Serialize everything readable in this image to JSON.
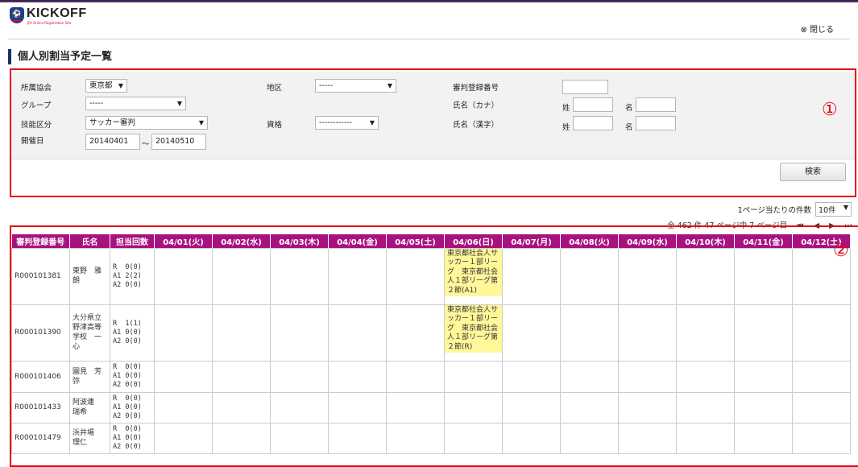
{
  "header": {
    "logo_text": "KICKOFF",
    "logo_sub": "JFA Online Registration Site",
    "close_label": "⊗ 閉じる"
  },
  "page_title": "個人別割当予定一覧",
  "search": {
    "association_label": "所属協会",
    "association_value": "東京都",
    "region_label": "地区",
    "region_value": "-----",
    "referee_no_label": "審判登録番号",
    "referee_no_value": "",
    "group_label": "グループ",
    "group_value": "-----",
    "kana_label": "氏名（カナ）",
    "skill_label": "技能区分",
    "skill_value": "サッカー審判",
    "qualification_label": "資格",
    "qualification_value": "------------",
    "kanji_label": "氏名（漢字）",
    "last_label": "姓",
    "first_label": "名",
    "date_label": "開催日",
    "date_from": "20140401",
    "date_sep": "～",
    "date_to": "20140510",
    "search_button": "検索"
  },
  "annotations": {
    "one": "①",
    "two": "②"
  },
  "pagination": {
    "per_page_label": "1ページ当たりの件数",
    "per_page_value": "10件",
    "summary": "全 462 件 47 ページ中 7 ページ目",
    "first": "⏮",
    "prev": "◀",
    "next": "▶",
    "last": "⏭"
  },
  "table": {
    "columns": [
      "審判登録番号",
      "氏名",
      "担当回数",
      "04/01(火)",
      "04/02(水)",
      "04/03(木)",
      "04/04(金)",
      "04/05(土)",
      "04/06(日)",
      "04/07(月)",
      "04/08(火)",
      "04/09(水)",
      "04/10(木)",
      "04/11(金)",
      "04/12(土)"
    ],
    "rows": [
      {
        "id": "R000101381",
        "name": "東野　雅朗",
        "counts": "R  0(0)\nA1 2(2)\nA2 0(0)",
        "day_index": 5,
        "assignment": "東京都社会人サッカー１部リーグ　東京都社会人１部リーグ第２節(A1)"
      },
      {
        "id": "R000101390",
        "name": "大分県立野津高等学校　一心",
        "counts": "R  1(1)\nA1 0(0)\nA2 0(0)",
        "day_index": 5,
        "assignment": "東京都社会人サッカー１部リーグ　東京都社会人１部リーグ第２節(R)"
      },
      {
        "id": "R000101406",
        "name": "園見　芳弥",
        "counts": "R  0(0)\nA1 0(0)\nA2 0(0)",
        "day_index": -1,
        "assignment": ""
      },
      {
        "id": "R000101433",
        "name": "阿波連　瑞希",
        "counts": "R  0(0)\nA1 0(0)\nA2 0(0)",
        "day_index": -1,
        "assignment": ""
      },
      {
        "id": "R000101479",
        "name": "浜井場　理仁",
        "counts": "R  0(0)\nA1 0(0)\nA2 0(0)",
        "day_index": -1,
        "assignment": ""
      }
    ]
  },
  "colors": {
    "header_bg": "#a8127f",
    "assigned_bg": "#fff799",
    "annotation": "#e60012",
    "title_bar": "#1a2f6e"
  }
}
